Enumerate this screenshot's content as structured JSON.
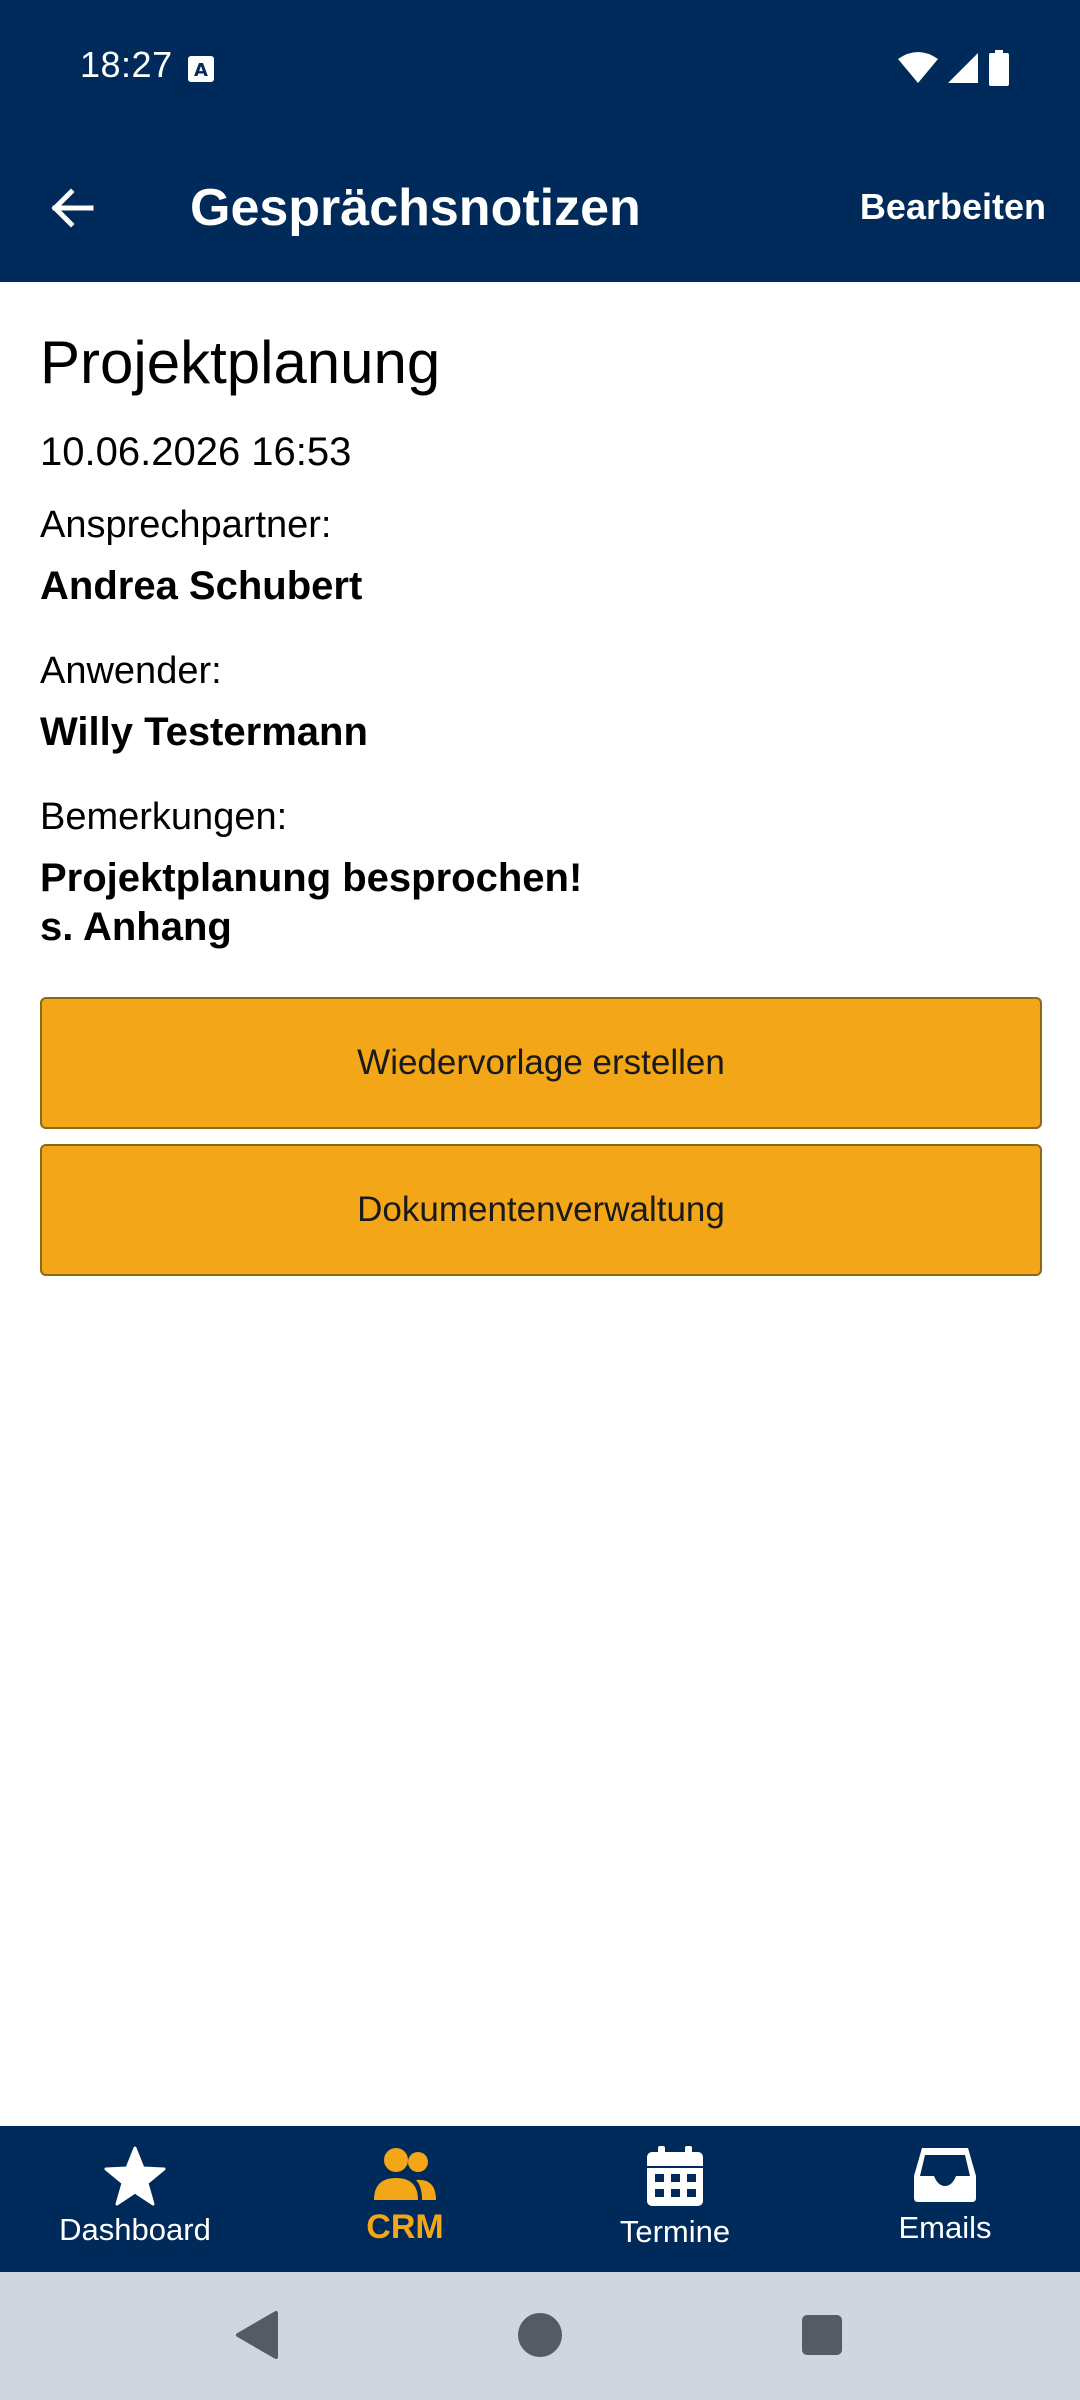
{
  "status_bar": {
    "time": "18:27"
  },
  "header": {
    "title": "Gesprächsnotizen",
    "edit_label": "Bearbeiten"
  },
  "note": {
    "title": "Projektplanung",
    "datetime": "10.06.2026 16:53",
    "contact_label": "Ansprechpartner:",
    "contact_value": "Andrea Schubert",
    "user_label": "Anwender:",
    "user_value": "Willy Testermann",
    "remarks_label": "Bemerkungen:",
    "remarks_line1": "Projektplanung besprochen!",
    "remarks_line2": "s. Anhang"
  },
  "actions": {
    "followup_label": "Wiedervorlage erstellen",
    "documents_label": "Dokumentenverwaltung"
  },
  "bottom_nav": {
    "items": [
      {
        "label": "Dashboard",
        "icon": "star-icon"
      },
      {
        "label": "CRM",
        "icon": "people-icon",
        "active": true
      },
      {
        "label": "Termine",
        "icon": "calendar-icon"
      },
      {
        "label": "Emails",
        "icon": "inbox-icon"
      }
    ]
  },
  "colors": {
    "primary": "#002a5a",
    "accent": "#f3a617",
    "system_nav": "#cfd6e0"
  }
}
